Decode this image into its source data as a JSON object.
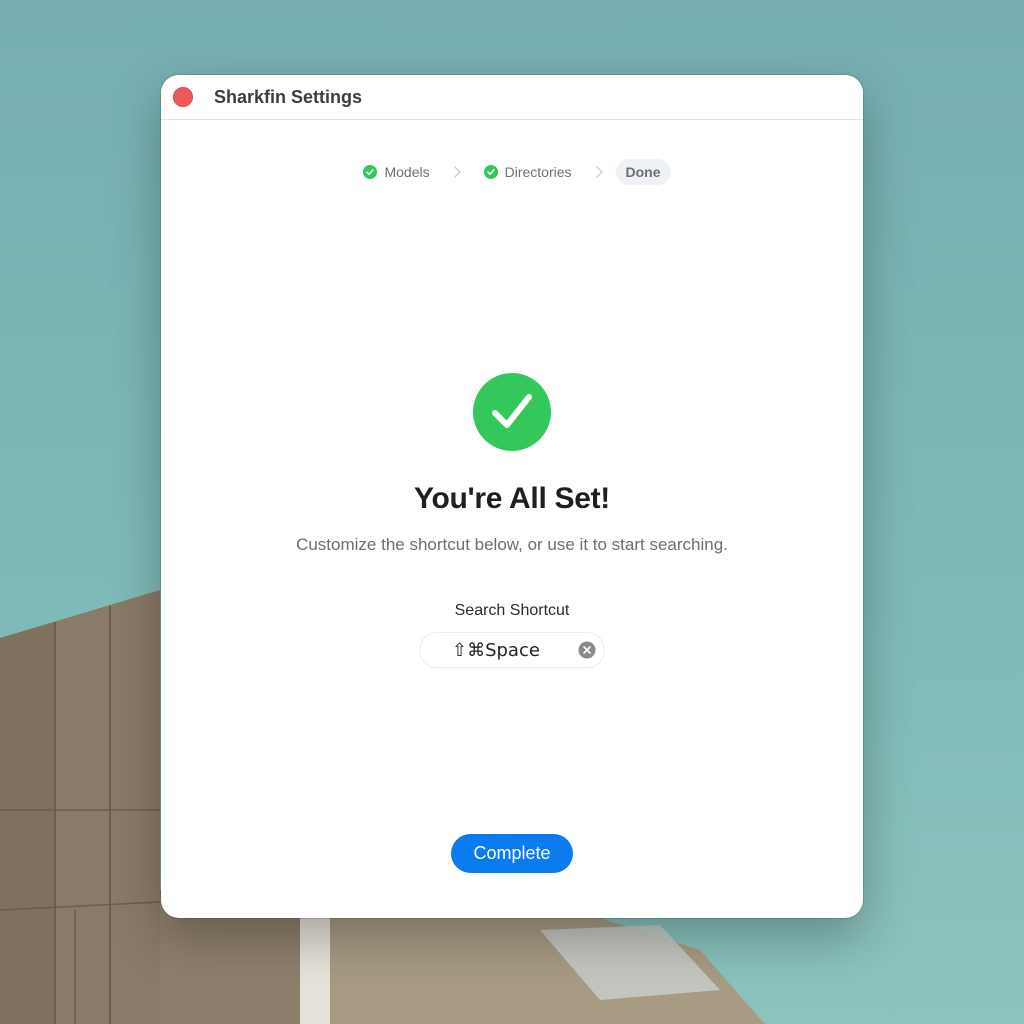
{
  "window": {
    "title": "Sharkfin Settings"
  },
  "steps": [
    {
      "label": "Models",
      "status": "complete"
    },
    {
      "label": "Directories",
      "status": "complete"
    },
    {
      "label": "Done",
      "status": "current"
    }
  ],
  "main": {
    "heading": "You're All Set!",
    "subtitle": "Customize the shortcut below, or use it to start searching."
  },
  "shortcut": {
    "label": "Search Shortcut",
    "value": "⇧⌘Space"
  },
  "footer": {
    "complete_label": "Complete"
  },
  "colors": {
    "accent": "#0a7cf0",
    "success": "#34c759",
    "close": "#ee5a5a"
  },
  "icons": {
    "close": "close-icon",
    "step_check": "checkmark-circle-icon",
    "chevron": "chevron-right-icon",
    "success": "checkmark-circle-large-icon",
    "clear": "clear-icon"
  }
}
